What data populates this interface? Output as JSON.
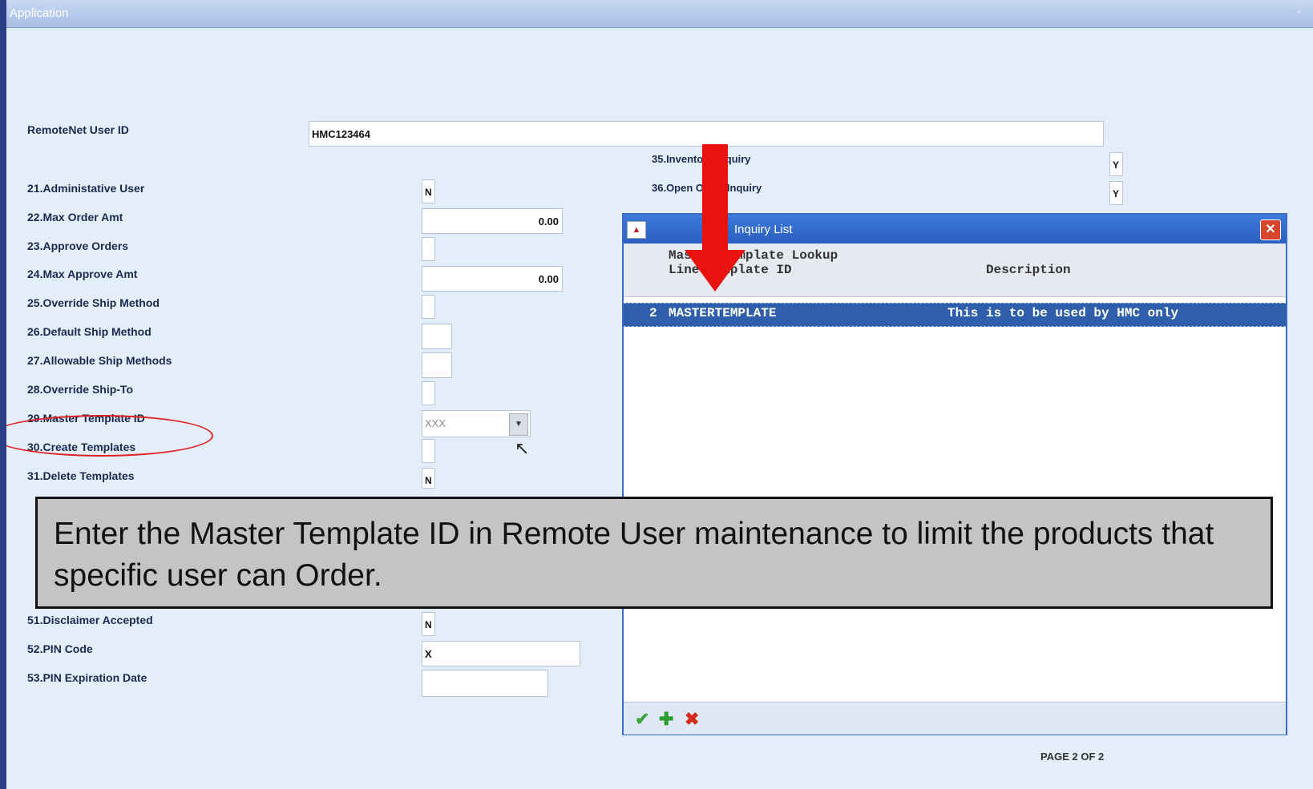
{
  "window": {
    "title": "Application"
  },
  "form": {
    "user_id_label": "RemoteNet User ID",
    "user_id_value": "HMC123464",
    "fields": [
      {
        "label": "21.Administative User",
        "value": "N"
      },
      {
        "label": "22.Max Order Amt",
        "value": "0.00"
      },
      {
        "label": "23.Approve Orders",
        "value": ""
      },
      {
        "label": "24.Max Approve Amt",
        "value": "0.00"
      },
      {
        "label": "25.Override Ship Method",
        "value": ""
      },
      {
        "label": "26.Default Ship Method",
        "value": ""
      },
      {
        "label": "27.Allowable Ship Methods",
        "value": ""
      },
      {
        "label": "28.Override Ship-To",
        "value": ""
      },
      {
        "label": "29.Master Template ID",
        "value": "XXX"
      },
      {
        "label": "30.Create Templates",
        "value": ""
      },
      {
        "label": "31.Delete Templates",
        "value": "N"
      },
      {
        "label": "51.Disclaimer Accepted",
        "value": "N"
      },
      {
        "label": "52.PIN Code",
        "value": "X"
      },
      {
        "label": "53.PIN Expiration Date",
        "value": ""
      }
    ],
    "right_fields": [
      {
        "label": "35.Inventory Inquiry",
        "value": "Y"
      },
      {
        "label": "36.Open Order Inquiry",
        "value": "Y"
      }
    ]
  },
  "lookup": {
    "title": "Inquiry List",
    "header_line1": "Master Template Lookup",
    "header_col1": "Line Template ID",
    "header_col2": "Description",
    "rows": [
      {
        "line": "2",
        "template_id": "MASTERTEMPLATE",
        "description": "This is to be used by HMC only"
      }
    ]
  },
  "caption": "Enter the Master Template ID in Remote User maintenance to limit the products that specific user can Order.",
  "page_indicator": "PAGE 2 OF 2",
  "icons": {
    "accept": "check-icon",
    "add": "plus-icon",
    "cancel": "x-icon"
  },
  "colors": {
    "arrow": "#e8120f",
    "highlight": "#e02222",
    "dialog_title": "#2b5fbf",
    "selected_row": "#2f5faa"
  }
}
